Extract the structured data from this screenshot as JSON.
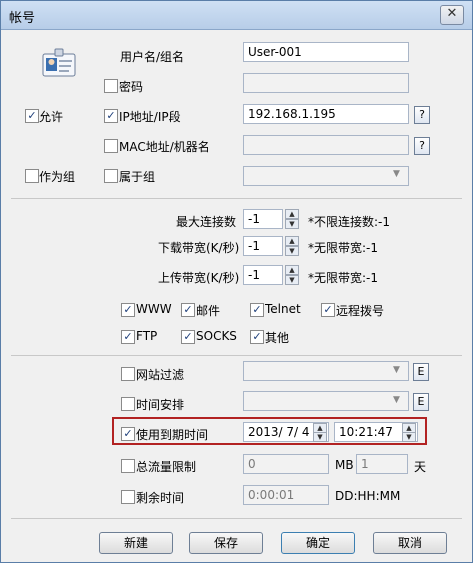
{
  "window": {
    "title": "帐号",
    "close_glyph": "✕"
  },
  "user": {
    "label": "用户名/组名",
    "value": "User-001"
  },
  "password": {
    "label": "密码",
    "checked": false,
    "value": ""
  },
  "allow": {
    "label": "允许",
    "checked": true
  },
  "ip": {
    "label": "IP地址/IP段",
    "checked": true,
    "value": "192.168.1.195",
    "help": "?"
  },
  "mac": {
    "label": "MAC地址/机器名",
    "checked": false,
    "value": "",
    "help": "?"
  },
  "as_group": {
    "label": "作为组",
    "checked": false
  },
  "belongs": {
    "label": "属于组",
    "checked": false,
    "value": ""
  },
  "limits": {
    "max_conn": {
      "label": "最大连接数",
      "value": "-1",
      "note": "不限连接数:-1"
    },
    "down": {
      "label": "下载带宽(K/秒)",
      "value": "-1",
      "note": "无限带宽:-1"
    },
    "up": {
      "label": "上传带宽(K/秒)",
      "value": "-1",
      "note": "无限带宽:-1"
    }
  },
  "services": [
    {
      "label": "WWW",
      "checked": true
    },
    {
      "label": "邮件",
      "checked": true
    },
    {
      "label": "Telnet",
      "checked": true
    },
    {
      "label": "远程拨号",
      "checked": true
    },
    {
      "label": "FTP",
      "checked": true
    },
    {
      "label": "SOCKS",
      "checked": true
    },
    {
      "label": "其他",
      "checked": true
    }
  ],
  "site_filter": {
    "label": "网站过滤",
    "checked": false,
    "e": "E"
  },
  "schedule": {
    "label": "时间安排",
    "checked": false,
    "e": "E"
  },
  "expiry": {
    "label": "使用到期时间",
    "checked": true,
    "date": "2013/ 7/ 4",
    "time": "10:21:47"
  },
  "traffic": {
    "label": "总流量限制",
    "checked": false,
    "value": "0",
    "unit_mb": "MB",
    "days_value": "1",
    "unit_day": "天"
  },
  "remaining": {
    "label": "剩余时间",
    "checked": false,
    "value": "0:00:01",
    "format": "DD:HH:MM"
  },
  "buttons": {
    "new": "新建",
    "save": "保存",
    "ok": "确定",
    "cancel": "取消"
  }
}
